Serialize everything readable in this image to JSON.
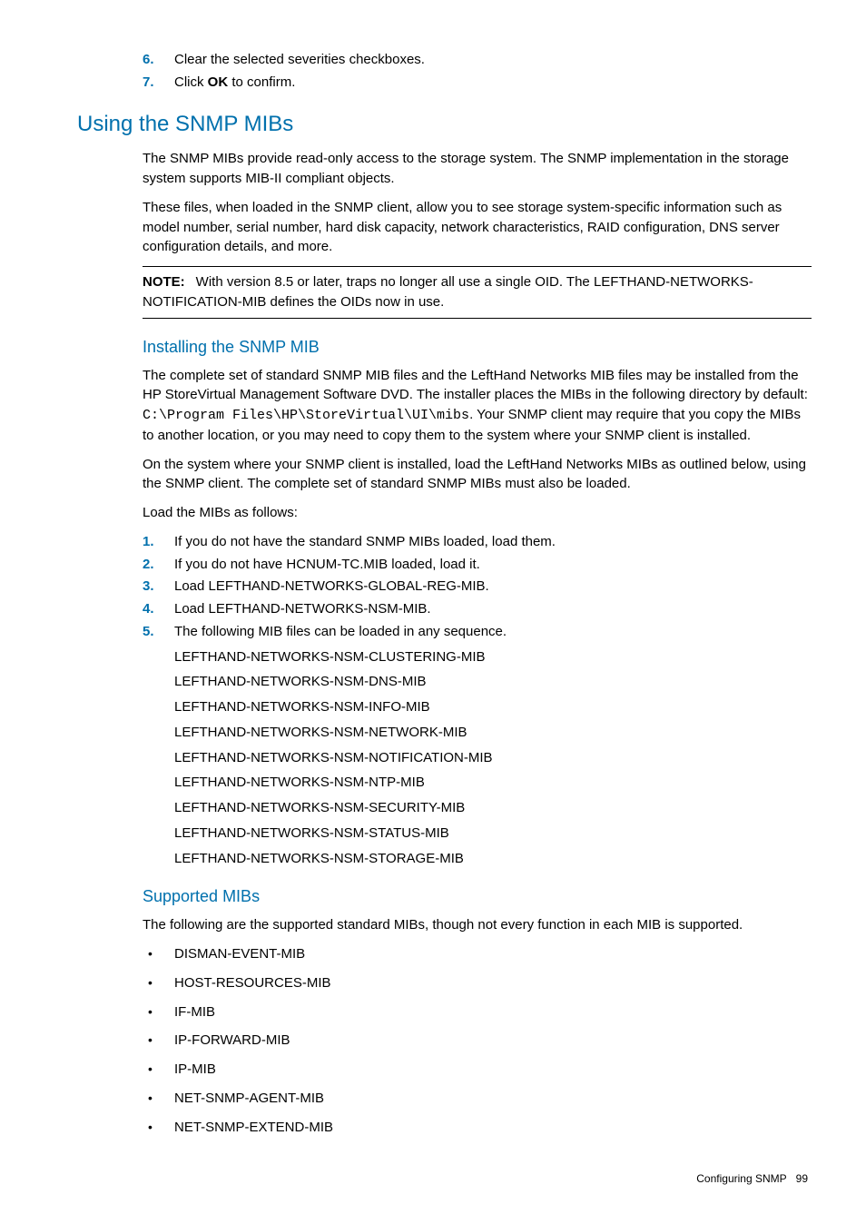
{
  "top_steps": [
    {
      "num": "6.",
      "text": "Clear the selected severities checkboxes."
    },
    {
      "num": "7.",
      "prefix": "Click ",
      "bold": "OK",
      "suffix": " to confirm."
    }
  ],
  "heading1": "Using the SNMP MIBs",
  "para1": "The SNMP MIBs provide read-only access to the storage system. The SNMP implementation in the storage system supports MIB-II compliant objects.",
  "para2": "These files, when loaded in the SNMP client, allow you to see storage system-specific information such as model number, serial number, hard disk capacity, network characteristics, RAID configuration, DNS server configuration details, and more.",
  "note": {
    "label": "NOTE:",
    "text": "With version 8.5 or later, traps no longer all use a single OID. The LEFTHAND-NETWORKS-NOTIFICATION-MIB defines the OIDs now in use."
  },
  "heading2a": "Installing the SNMP MIB",
  "install": {
    "p1_pre": "The complete set of standard SNMP MIB files and the LeftHand Networks MIB files may be installed from the HP StoreVirtual Management Software DVD. The installer places the MIBs in the following directory by default: ",
    "p1_code": "C:\\Program Files\\HP\\StoreVirtual\\UI\\mibs",
    "p1_post": ". Your SNMP client may require that you copy the MIBs to another location, or you may need to copy them to the system where your SNMP client is installed.",
    "p2": "On the system where your SNMP client is installed, load the LeftHand Networks MIBs as outlined below, using the SNMP client. The complete set of standard SNMP MIBs must also be loaded.",
    "p3": "Load the MIBs as follows:"
  },
  "load_steps": [
    {
      "num": "1.",
      "text": "If you do not have the standard SNMP MIBs loaded, load them."
    },
    {
      "num": "2.",
      "text": "If you do not have HCNUM-TC.MIB loaded, load it."
    },
    {
      "num": "3.",
      "text": "Load LEFTHAND-NETWORKS-GLOBAL-REG-MIB."
    },
    {
      "num": "4.",
      "text": "Load LEFTHAND-NETWORKS-NSM-MIB."
    },
    {
      "num": "5.",
      "text": "The following MIB files can be loaded in any sequence."
    }
  ],
  "mib_files": [
    "LEFTHAND-NETWORKS-NSM-CLUSTERING-MIB",
    "LEFTHAND-NETWORKS-NSM-DNS-MIB",
    "LEFTHAND-NETWORKS-NSM-INFO-MIB",
    "LEFTHAND-NETWORKS-NSM-NETWORK-MIB",
    "LEFTHAND-NETWORKS-NSM-NOTIFICATION-MIB",
    "LEFTHAND-NETWORKS-NSM-NTP-MIB",
    "LEFTHAND-NETWORKS-NSM-SECURITY-MIB",
    "LEFTHAND-NETWORKS-NSM-STATUS-MIB",
    "LEFTHAND-NETWORKS-NSM-STORAGE-MIB"
  ],
  "heading2b": "Supported MIBs",
  "supported_intro": "The following are the supported standard MIBs, though not every function in each MIB is supported.",
  "supported_mibs": [
    "DISMAN-EVENT-MIB",
    "HOST-RESOURCES-MIB",
    "IF-MIB",
    "IP-FORWARD-MIB",
    "IP-MIB",
    "NET-SNMP-AGENT-MIB",
    "NET-SNMP-EXTEND-MIB"
  ],
  "footer": {
    "title": "Configuring SNMP",
    "page": "99"
  }
}
